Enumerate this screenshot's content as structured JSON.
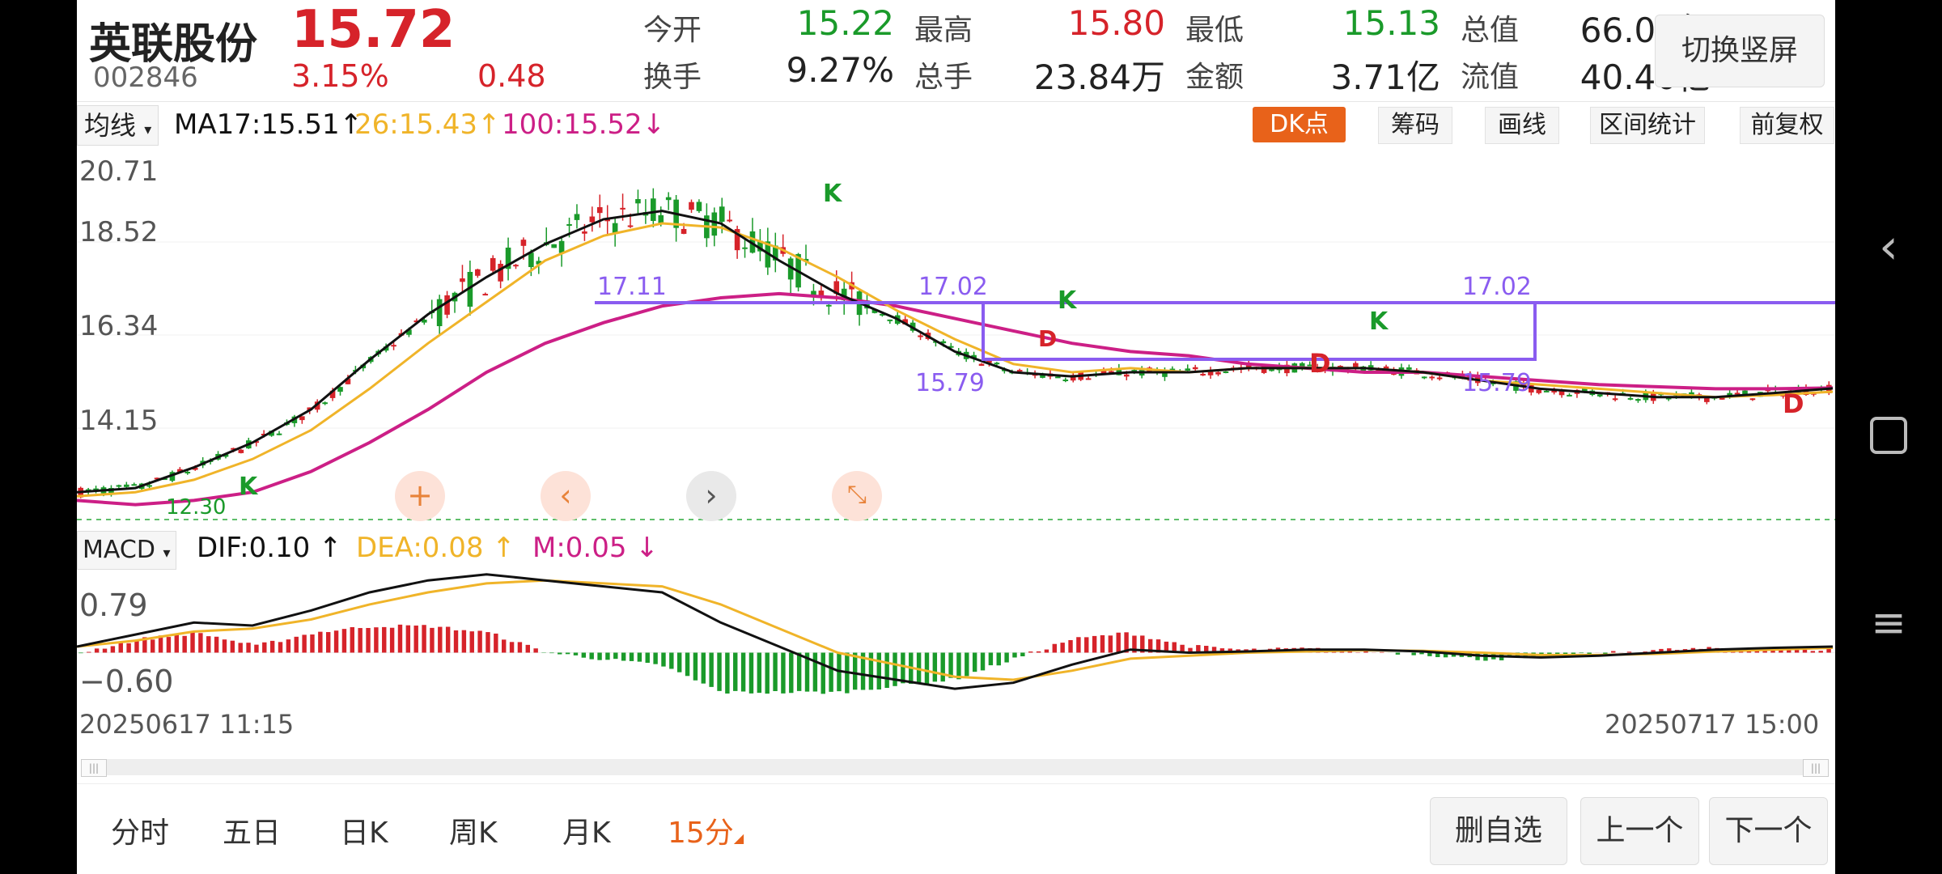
{
  "header": {
    "stock_name": "英联股份",
    "price": "15.72",
    "code": "002846",
    "change_pct": "3.15%",
    "change_amt": "0.48",
    "switch_button": "切换竖屏",
    "stats": [
      {
        "label": "今开",
        "value": "15.22",
        "color": "#1a9a2a"
      },
      {
        "label": "最高",
        "value": "15.80",
        "color": "#d6232a"
      },
      {
        "label": "最低",
        "value": "15.13",
        "color": "#1a9a2a"
      },
      {
        "label": "总值",
        "value": "66.02亿",
        "color": "#222222"
      },
      {
        "label": "换手",
        "value": "9.27%",
        "color": "#222222"
      },
      {
        "label": "总手",
        "value": "23.84万",
        "color": "#222222"
      },
      {
        "label": "金额",
        "value": "3.71亿",
        "color": "#222222"
      },
      {
        "label": "流值",
        "value": "40.40亿",
        "color": "#222222"
      }
    ]
  },
  "ma_bar": {
    "selector": "均线",
    "ma17": "MA17:15.51",
    "ma17_arrow": "↑",
    "ma26": "26:15.43",
    "ma26_arrow": "↑",
    "ma100": "100:15.52",
    "ma100_arrow": "↓",
    "dk_button": "DK点",
    "tools": [
      "筹码",
      "画线",
      "区间统计",
      "前复权"
    ]
  },
  "price_axis": [
    "20.71",
    "18.52",
    "16.34",
    "14.15"
  ],
  "annotations": {
    "top_left_level": "17.11",
    "top_mid_level": "17.02",
    "top_right_level": "17.02",
    "bottom_mid_level": "15.79",
    "bottom_right_level": "15.79",
    "bottom_left_label": "12.30",
    "k_label": "K",
    "d_label": "D"
  },
  "macd_bar": {
    "selector": "MACD",
    "dif": "DIF:0.10",
    "dif_arrow": "↑",
    "dea": "DEA:0.08",
    "dea_arrow": "↑",
    "m": "M:0.05",
    "m_arrow": "↓",
    "axis": [
      "0.79",
      "−0.60"
    ]
  },
  "time_axis": {
    "start": "20250617 11:15",
    "end": "20250717 15:00"
  },
  "tabs": [
    "分时",
    "五日",
    "日K",
    "周K",
    "月K",
    "15分"
  ],
  "active_tab": "15分",
  "bottom_buttons": [
    "删自选",
    "上一个",
    "下一个"
  ],
  "colors": {
    "up": "#d6232a",
    "down": "#1a9a2a",
    "ma17": "#111111",
    "ma26": "#f0b429",
    "ma100": "#cc1f86",
    "box": "#8a5cf0",
    "accent": "#e8621a"
  },
  "chart_data": {
    "type": "candlestick",
    "x_range": [
      "20250617 11:15",
      "20250717 15:00"
    ],
    "ylim": [
      12.3,
      21.3
    ],
    "ma17": [
      13.0,
      13.1,
      13.6,
      14.2,
      15.0,
      16.2,
      17.3,
      18.2,
      19.0,
      19.6,
      19.8,
      19.5,
      18.6,
      17.8,
      17.2,
      16.4,
      15.9,
      15.8,
      15.9,
      15.9,
      16.0,
      16.0,
      16.0,
      15.9,
      15.7,
      15.5,
      15.4,
      15.3,
      15.3,
      15.4,
      15.51
    ],
    "ma26": [
      12.9,
      13.0,
      13.3,
      13.8,
      14.5,
      15.5,
      16.6,
      17.6,
      18.6,
      19.2,
      19.5,
      19.4,
      18.9,
      18.2,
      17.4,
      16.7,
      16.1,
      15.9,
      16.0,
      15.9,
      16.0,
      16.0,
      16.0,
      15.9,
      15.7,
      15.6,
      15.5,
      15.4,
      15.3,
      15.35,
      15.43
    ],
    "ma100": [
      12.8,
      12.7,
      12.8,
      13.0,
      13.5,
      14.2,
      15.0,
      15.9,
      16.6,
      17.1,
      17.5,
      17.7,
      17.8,
      17.7,
      17.5,
      17.2,
      16.9,
      16.6,
      16.4,
      16.3,
      16.1,
      16.0,
      15.9,
      15.9,
      15.8,
      15.7,
      15.6,
      15.55,
      15.5,
      15.5,
      15.52
    ],
    "dif": [
      0.1,
      0.3,
      0.5,
      0.45,
      0.7,
      1.0,
      1.2,
      1.3,
      1.2,
      1.1,
      1.0,
      0.5,
      0.1,
      -0.3,
      -0.45,
      -0.6,
      -0.5,
      -0.2,
      0.05,
      0.0,
      0.02,
      0.05,
      0.05,
      0.02,
      -0.05,
      -0.08,
      -0.05,
      0.0,
      0.05,
      0.08,
      0.1
    ],
    "dea": [
      0.1,
      0.2,
      0.35,
      0.4,
      0.55,
      0.8,
      1.0,
      1.15,
      1.2,
      1.15,
      1.1,
      0.8,
      0.4,
      0.0,
      -0.2,
      -0.4,
      -0.45,
      -0.3,
      -0.1,
      -0.05,
      0.0,
      0.02,
      0.04,
      0.03,
      0.0,
      -0.04,
      -0.04,
      -0.02,
      0.02,
      0.05,
      0.08
    ]
  }
}
